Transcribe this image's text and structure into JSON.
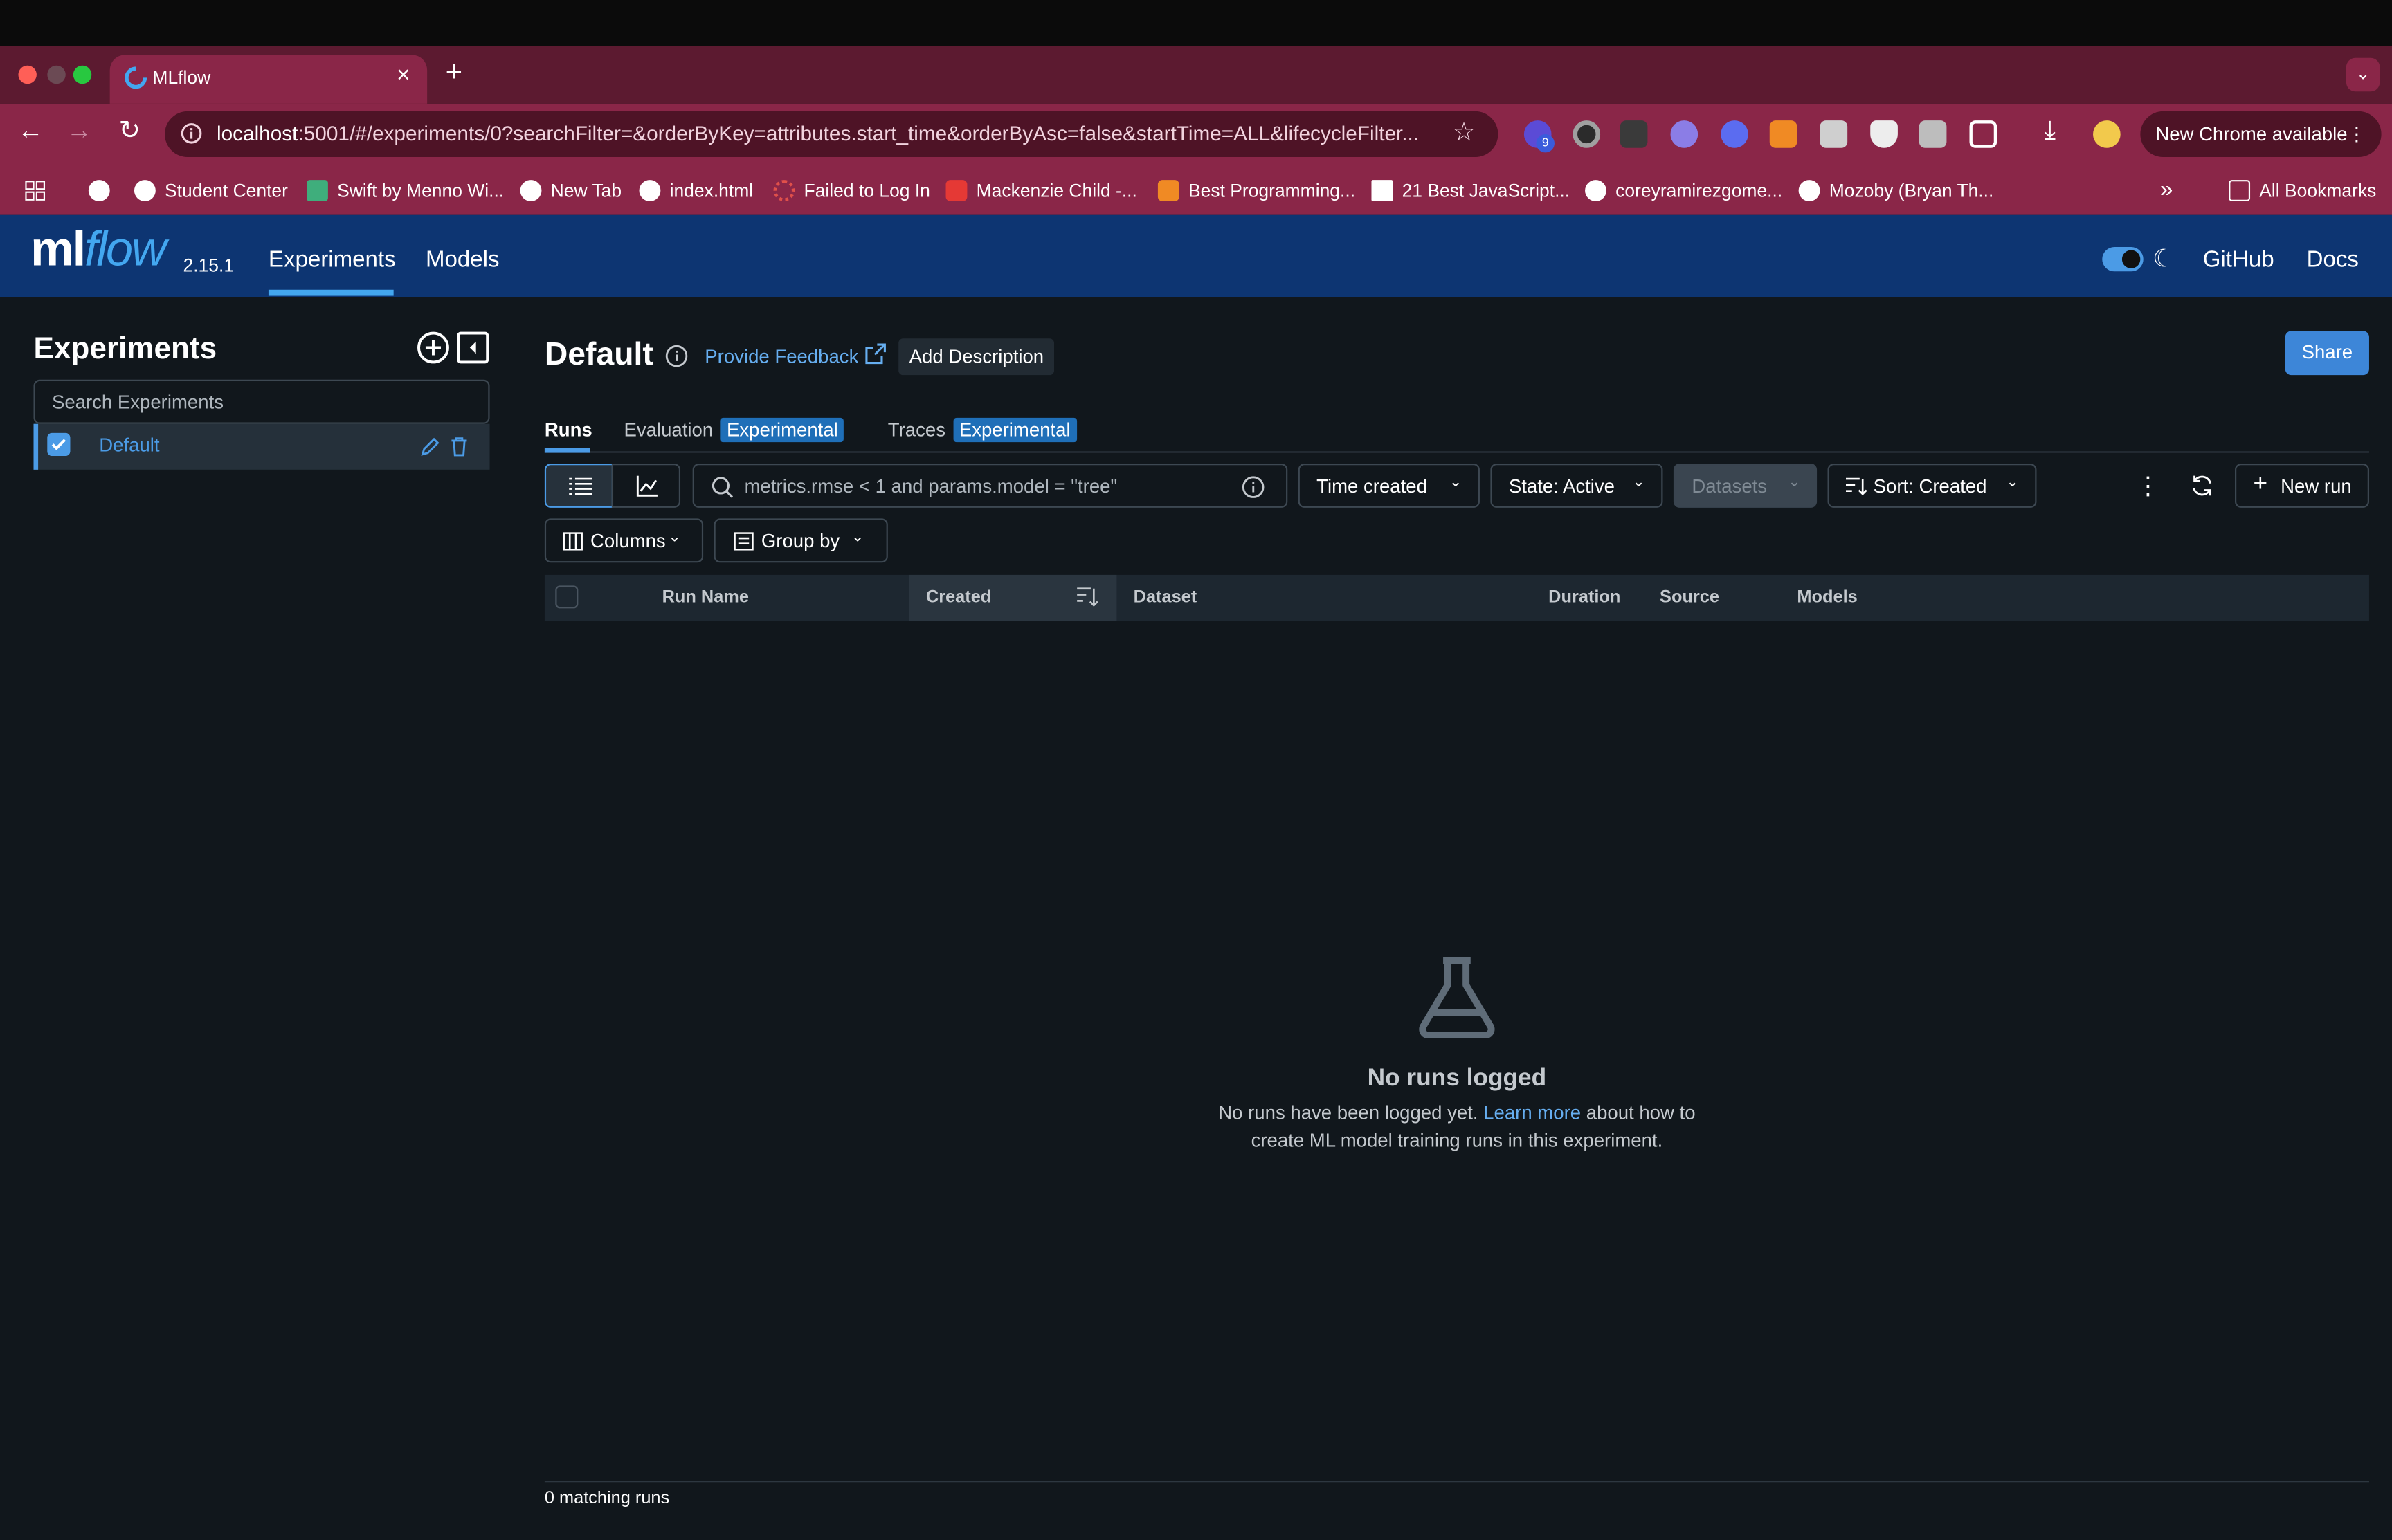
{
  "browser": {
    "tab_title": "MLflow",
    "url_host": "localhost",
    "url_rest": ":5001/#/experiments/0?searchFilter=&orderByKey=attributes.start_time&orderByAsc=false&startTime=ALL&lifecycleFilter...",
    "extension_badge": "9",
    "update_label": "New Chrome available",
    "bookmarks": [
      "Student Center",
      "Swift by Menno Wi...",
      "New Tab",
      "index.html",
      "Failed to Log In",
      "Mackenzie Child -...",
      "Best Programming...",
      "21 Best JavaScript...",
      "coreyramirezgome...",
      "Mozoby (Bryan Th..."
    ],
    "all_bookmarks": "All Bookmarks"
  },
  "header": {
    "logo_ml": "ml",
    "logo_flow": "flow",
    "version": "2.15.1",
    "nav": [
      "Experiments",
      "Models"
    ],
    "right_links": [
      "GitHub",
      "Docs"
    ]
  },
  "sidebar": {
    "title": "Experiments",
    "search_placeholder": "Search Experiments",
    "items": [
      {
        "label": "Default",
        "selected": true
      }
    ]
  },
  "main": {
    "title": "Default",
    "feedback": "Provide Feedback",
    "add_description": "Add Description",
    "share": "Share",
    "tabs": [
      {
        "label": "Runs"
      },
      {
        "label": "Evaluation",
        "badge": "Experimental"
      },
      {
        "label": "Traces",
        "badge": "Experimental"
      }
    ],
    "search_placeholder": "metrics.rmse < 1 and params.model = \"tree\"",
    "filters": {
      "time": "Time created",
      "state": "State: Active",
      "datasets": "Datasets",
      "sort": "Sort: Created",
      "new_run": "New run",
      "columns": "Columns",
      "group_by": "Group by"
    },
    "table_headers": [
      "Run Name",
      "Created",
      "Dataset",
      "Duration",
      "Source",
      "Models"
    ],
    "empty": {
      "title": "No runs logged",
      "line1_pre": "No runs have been logged yet. ",
      "line1_link": "Learn more",
      "line1_post": " about how to",
      "line2": "create ML model training runs in this experiment."
    },
    "footer": "0 matching runs"
  },
  "colors": {
    "accent": "#4b9be6",
    "header_bg": "#0d3572",
    "page_bg": "#11171c",
    "chrome_tab": "#8a2648"
  }
}
